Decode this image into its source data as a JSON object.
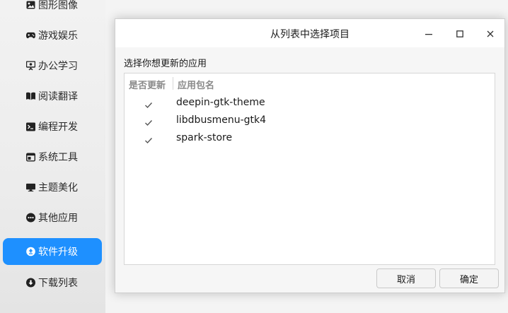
{
  "sidebar": {
    "items": [
      {
        "label": "图形图像",
        "icon": "image-icon"
      },
      {
        "label": "游戏娱乐",
        "icon": "gamepad-icon"
      },
      {
        "label": "办公学习",
        "icon": "presentation-icon"
      },
      {
        "label": "阅读翻译",
        "icon": "book-icon"
      },
      {
        "label": "编程开发",
        "icon": "terminal-icon"
      },
      {
        "label": "系统工具",
        "icon": "window-icon"
      },
      {
        "label": "主题美化",
        "icon": "monitor-icon"
      },
      {
        "label": "其他应用",
        "icon": "more-icon"
      },
      {
        "label": "软件升级",
        "icon": "upgrade-icon"
      },
      {
        "label": "下载列表",
        "icon": "download-icon"
      }
    ],
    "active_index": 8
  },
  "dialog": {
    "title": "从列表中选择项目",
    "prompt": "选择你想更新的应用",
    "columns": [
      "是否更新",
      "应用包名"
    ],
    "rows": [
      {
        "checked": true,
        "name": "deepin-gtk-theme"
      },
      {
        "checked": true,
        "name": "libdbusmenu-gtk4"
      },
      {
        "checked": true,
        "name": "spark-store"
      }
    ],
    "cancel_label": "取消",
    "ok_label": "确定"
  },
  "colors": {
    "accent": "#1e90ff",
    "dialog_bg": "#f6f6f6",
    "titlebar_bg": "#ffffff"
  }
}
